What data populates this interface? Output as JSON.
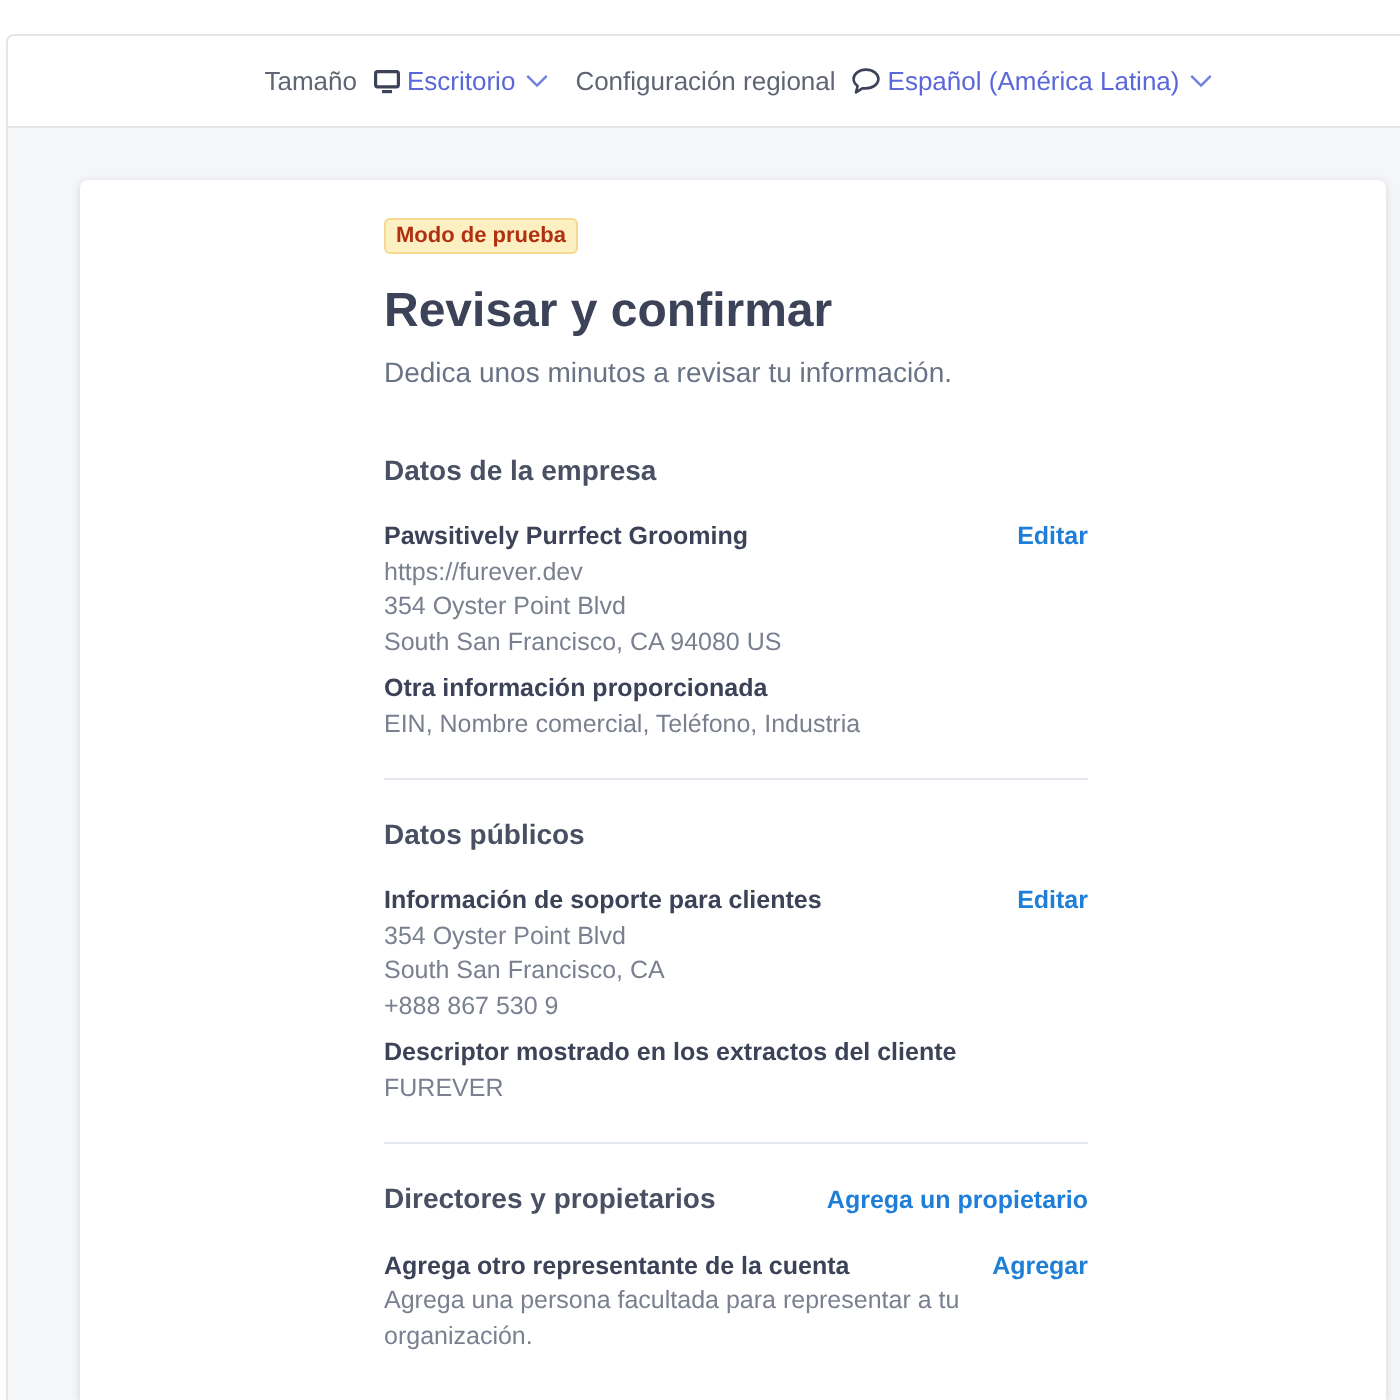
{
  "toolbar": {
    "size": {
      "label": "Tamaño",
      "value": "Escritorio"
    },
    "locale": {
      "label": "Configuración regional",
      "value": "Español (América Latina)"
    }
  },
  "badge": "Modo de prueba",
  "title": "Revisar y confirmar",
  "subtitle": "Dedica unos minutos a revisar tu información.",
  "sections": [
    {
      "heading": "Datos de la empresa",
      "items": [
        {
          "title": "Pawsitively Purrfect Grooming",
          "action": "Editar",
          "lines": [
            "https://furever.dev",
            "354 Oyster Point Blvd",
            "South San Francisco, CA 94080 US"
          ]
        },
        {
          "title": "Otra información proporcionada",
          "lines": [
            "EIN, Nombre comercial, Teléfono, Industria"
          ]
        }
      ]
    },
    {
      "heading": "Datos públicos",
      "items": [
        {
          "title": "Información de soporte para clientes",
          "action": "Editar",
          "lines": [
            "354 Oyster Point Blvd",
            "South San Francisco, CA",
            "+888 867 530 9"
          ]
        },
        {
          "title": "Descriptor mostrado en los extractos del cliente",
          "lines": [
            "FUREVER"
          ]
        }
      ]
    },
    {
      "heading": "Directores y propietarios",
      "action": "Agrega un propietario",
      "items": [
        {
          "title": "Agrega otro representante de la cuenta",
          "action": "Agregar",
          "lines": [
            "Agrega una persona facultada para representar a tu organización."
          ]
        }
      ]
    }
  ]
}
